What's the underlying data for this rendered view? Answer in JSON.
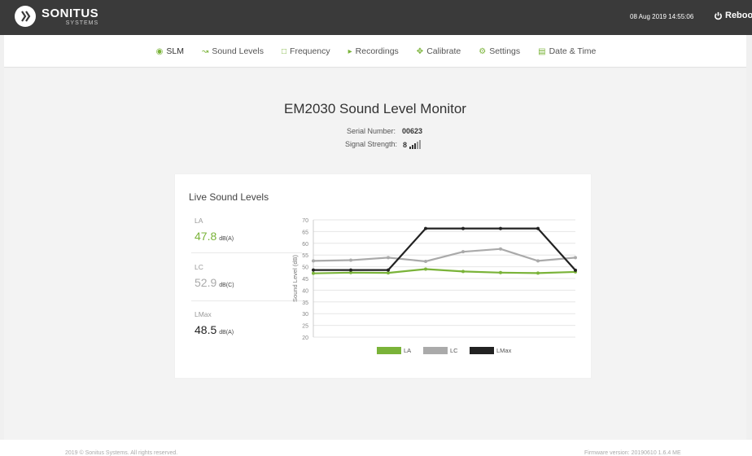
{
  "header": {
    "brand_name": "SONITUS",
    "brand_sub": "SYSTEMS",
    "datetime": "08 Aug 2019 14:55:06",
    "reboot_label": "Reboot"
  },
  "nav": {
    "items": [
      {
        "label": "SLM",
        "icon": "dashboard-icon"
      },
      {
        "label": "Sound Levels",
        "icon": "line-chart-icon"
      },
      {
        "label": "Frequency",
        "icon": "bar-chart-icon"
      },
      {
        "label": "Recordings",
        "icon": "speaker-icon"
      },
      {
        "label": "Calibrate",
        "icon": "crosshair-icon"
      },
      {
        "label": "Settings",
        "icon": "cogs-icon"
      },
      {
        "label": "Date & Time",
        "icon": "calendar-icon"
      }
    ]
  },
  "main": {
    "title": "EM2030 Sound Level Monitor",
    "serial_label": "Serial Number:",
    "serial_value": "00623",
    "signal_label": "Signal Strength:",
    "signal_value": "8"
  },
  "live": {
    "title": "Live Sound Levels",
    "metrics": [
      {
        "name": "LA",
        "value": "47.8",
        "unit": "dB(A)",
        "color": "#7ab339"
      },
      {
        "name": "LC",
        "value": "52.9",
        "unit": "dB(C)",
        "color": "#aaaaaa"
      },
      {
        "name": "LMax",
        "value": "48.5",
        "unit": "dB(A)",
        "color": "#222222"
      }
    ]
  },
  "chart_data": {
    "type": "line",
    "ylabel": "Sound Level (dB)",
    "ylim": [
      20,
      70
    ],
    "yticks": [
      70,
      65,
      60,
      55,
      50,
      45,
      40,
      35,
      30,
      25,
      20
    ],
    "grid": true,
    "legend_position": "bottom",
    "series": [
      {
        "name": "LA",
        "color": "#7ab339",
        "values": [
          47.2,
          47.5,
          47.4,
          49.0,
          48.0,
          47.5,
          47.3,
          47.8
        ]
      },
      {
        "name": "LC",
        "color": "#aaaaaa",
        "values": [
          52.5,
          52.8,
          53.9,
          52.3,
          56.4,
          57.6,
          52.5,
          53.9
        ]
      },
      {
        "name": "LMax",
        "color": "#222222",
        "values": [
          48.6,
          48.6,
          48.6,
          66.3,
          66.3,
          66.3,
          66.3,
          48.5
        ]
      }
    ]
  },
  "footer": {
    "copyright": "2019 © Sonitus Systems. All rights reserved.",
    "firmware": "Firmware version: 20190610 1.6.4 ME"
  }
}
